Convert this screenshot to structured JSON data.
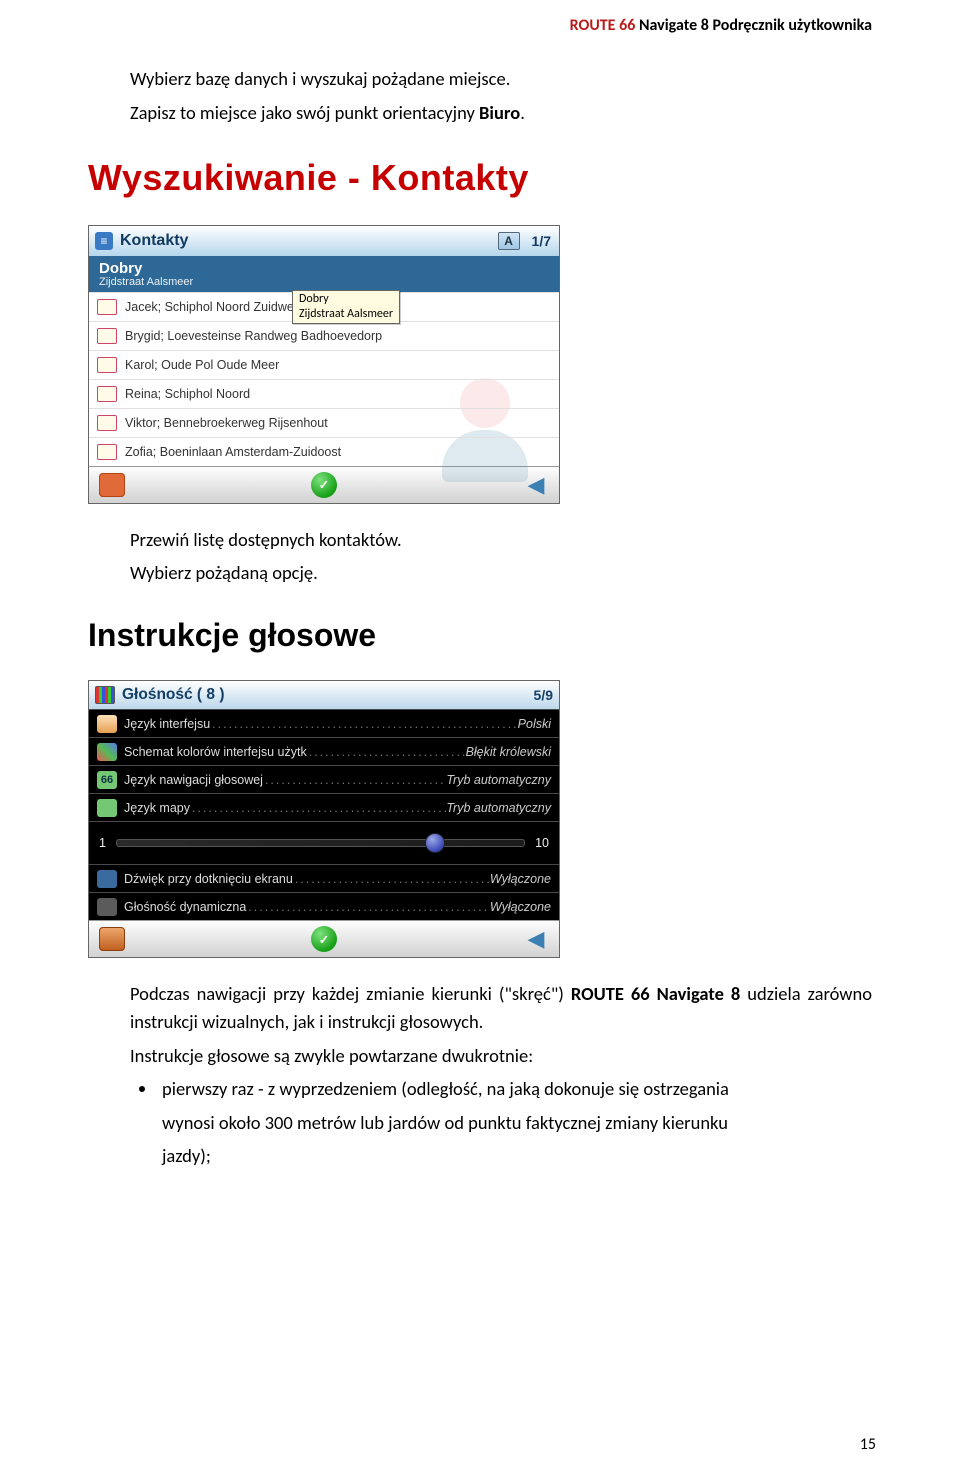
{
  "header": {
    "brand": "ROUTE 66",
    "suffix": " Navigate 8 Podręcznik użytkownika"
  },
  "intro": {
    "line1": "Wybierz bazę danych i wyszukaj pożądane miejsce.",
    "line2_pre": "Zapisz to miejsce jako swój punkt orientacyjny ",
    "line2_bold": "Biuro",
    "line2_post": "."
  },
  "section1_title": "Wyszukiwanie - Kontakty",
  "shot1": {
    "title": "Kontakty",
    "counter": "1/7",
    "selected": {
      "name": "Dobry",
      "addr": "Zijdstraat Aalsmeer"
    },
    "tooltip": {
      "l1": "Dobry",
      "l2": "Zijdstraat Aalsmeer"
    },
    "rows": [
      "Jacek; Schiphol Noord Zuidwest Badhoevedorp",
      "Brygid; Loevesteinse Randweg Badhoevedorp",
      "Karol; Oude Pol Oude Meer",
      "Reina; Schiphol Noord",
      "Viktor; Bennebroekerweg Rijsenhout",
      "Zofia; Boeninlaan Amsterdam-Zuidoost"
    ]
  },
  "after1": {
    "l1": "Przewiń listę dostępnych kontaktów.",
    "l2": "Wybierz pożądaną opcję."
  },
  "section2_title": "Instrukcje głosowe",
  "shot2": {
    "title": "Głośność ( 8 )",
    "counter": "5/9",
    "rows": [
      {
        "icon": "user",
        "label": "Język interfejsu",
        "value": "Polski"
      },
      {
        "icon": "pal",
        "label": "Schemat kolorów interfejsu użytk",
        "value": "Błękit królewski"
      },
      {
        "icon": "voice",
        "label": "Język nawigacji głosowej",
        "value": "Tryb automatyczny"
      },
      {
        "icon": "map",
        "label": "Język mapy",
        "value": "Tryb automatyczny"
      }
    ],
    "slider": {
      "min": "1",
      "max": "10",
      "pos_percent": 78
    },
    "rows2": [
      {
        "icon": "snd",
        "label": "Dźwięk przy dotknięciu ekranu",
        "value": "Wyłączone"
      },
      {
        "icon": "dyn",
        "label": "Głośność dynamiczna",
        "value": "Wyłączone"
      }
    ]
  },
  "para": {
    "pre": "Podczas nawigacji przy każdej zmianie kierunki (\"skręć\") ",
    "brand": "ROUTE 66 Navigate 8",
    "post": " udziela zarówno instrukcji wizualnych, jak i instrukcji głosowych.",
    "l2": "Instrukcje głosowe są zwykle powtarzane dwukrotnie:"
  },
  "bullet": {
    "line1": "pierwszy raz - z wyprzedzeniem (odległość, na jaką dokonuje się ostrzegania",
    "line2": "wynosi około 300 metrów lub jardów od punktu faktycznej zmiany kierunku",
    "line3": "jazdy);"
  },
  "page_num": "15"
}
